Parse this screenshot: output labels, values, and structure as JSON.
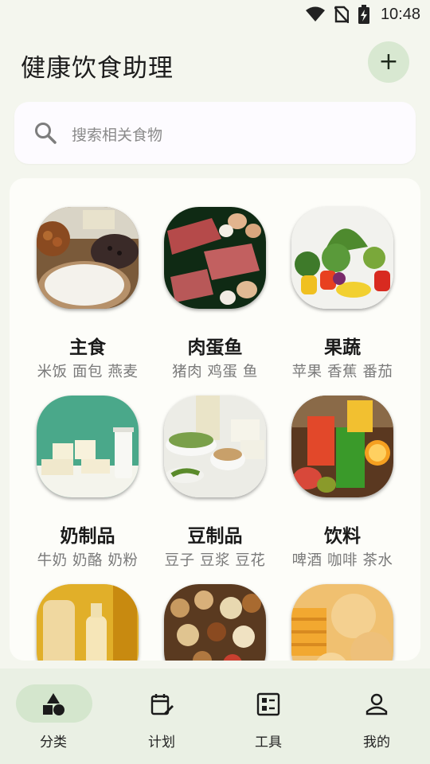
{
  "status_bar": {
    "time": "10:48",
    "icons": [
      "wifi-icon",
      "no-sim-icon",
      "battery-charging-icon"
    ]
  },
  "app": {
    "title": "健康饮食助理",
    "add_icon": "plus-icon"
  },
  "search": {
    "placeholder": "搜索相关食物",
    "icon": "search-icon"
  },
  "categories": [
    {
      "name": "主食",
      "subtitle": "米饭 面包 燕麦"
    },
    {
      "name": "肉蛋鱼",
      "subtitle": "猪肉 鸡蛋 鱼"
    },
    {
      "name": "果蔬",
      "subtitle": "苹果 香蕉 番茄"
    },
    {
      "name": "奶制品",
      "subtitle": "牛奶 奶酪 奶粉"
    },
    {
      "name": "豆制品",
      "subtitle": "豆子 豆浆 豆花"
    },
    {
      "name": "饮料",
      "subtitle": "啤酒 咖啡 茶水"
    }
  ],
  "bottom_nav": [
    {
      "label": "分类",
      "icon": "category-shapes-icon",
      "selected": true
    },
    {
      "label": "计划",
      "icon": "calendar-edit-icon",
      "selected": false
    },
    {
      "label": "工具",
      "icon": "tools-grid-icon",
      "selected": false
    },
    {
      "label": "我的",
      "icon": "person-icon",
      "selected": false
    }
  ],
  "colors": {
    "background": "#f4f6ee",
    "accent_pill": "#d4e6cd",
    "add_button": "#d8e8d1",
    "nav_bar": "#eaf0e4"
  }
}
